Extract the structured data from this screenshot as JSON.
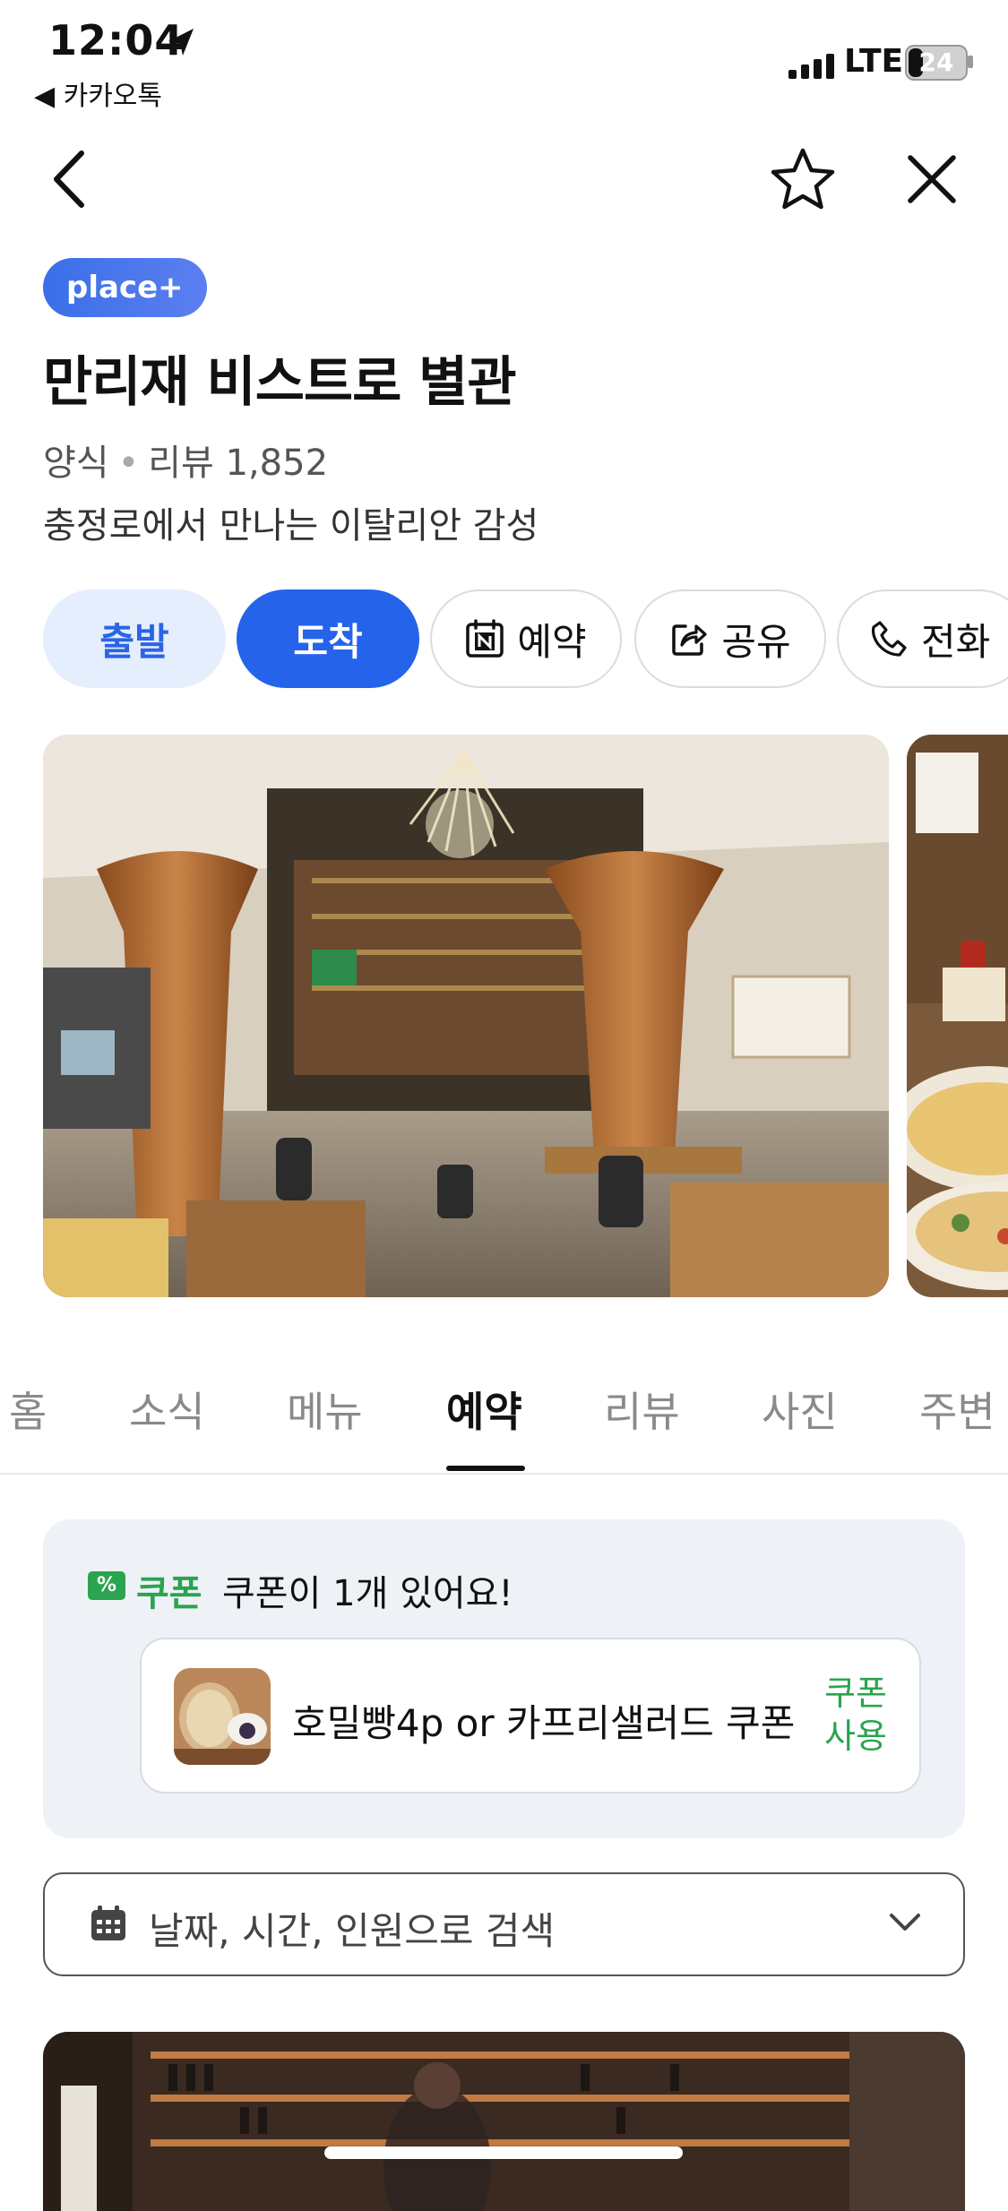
{
  "status_bar": {
    "time": "12:04",
    "back_app": "◀ 카카오톡",
    "network": "LTE",
    "battery": "24",
    "battery_level": 0.24
  },
  "nav": {
    "back_icon": "chevron-left-icon",
    "favorite_icon": "star-outline-icon",
    "close_icon": "close-icon"
  },
  "place": {
    "badge": "place+",
    "name": "만리재 비스트로 별관",
    "category": "양식",
    "reviews": "리뷰 1,852",
    "description": "충정로에서 만나는 이탈리안 감성"
  },
  "actions": {
    "start": "출발",
    "arrive": "도착",
    "reserve": "예약",
    "share": "공유",
    "call": "전화"
  },
  "tabs": [
    "홈",
    "소식",
    "메뉴",
    "예약",
    "리뷰",
    "사진",
    "주변"
  ],
  "active_tab": "예약",
  "coupon": {
    "icon_text": "%",
    "tag": "쿠폰",
    "message": "쿠폰이 1개 있어요!",
    "item_name": "호밀빵4p or 카프리샐러드 쿠폰",
    "use_line1": "쿠폰",
    "use_line2": "사용"
  },
  "search": {
    "placeholder": "날짜, 시간, 인원으로 검색"
  },
  "colors": {
    "primary_blue": "#2563eb",
    "light_blue": "#e4eefc",
    "coupon_green": "#2aa44f",
    "coupon_bg": "#eef2f7"
  }
}
